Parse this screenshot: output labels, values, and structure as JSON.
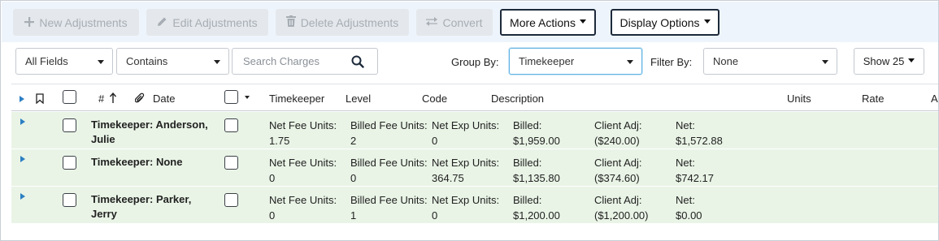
{
  "toolbar": {
    "new_label": "New Adjustments",
    "edit_label": "Edit Adjustments",
    "delete_label": "Delete Adjustments",
    "convert_label": "Convert",
    "more_actions_label": "More Actions",
    "display_options_label": "Display Options"
  },
  "filters": {
    "field_select": "All Fields",
    "operator_select": "Contains",
    "search_placeholder": "Search Charges",
    "group_by_label": "Group By:",
    "group_by_value": "Timekeeper",
    "filter_by_label": "Filter By:",
    "filter_by_value": "None",
    "show_label": "Show 25"
  },
  "table": {
    "headers": {
      "number": "#",
      "date": "Date",
      "timekeeper": "Timekeeper",
      "level": "Level",
      "code": "Code",
      "description": "Description",
      "units": "Units",
      "rate": "Rate",
      "amount_cut": "A"
    },
    "groups": [
      {
        "name": "Timekeeper: Anderson, Julie",
        "net_fee_units_label": "Net Fee Units:",
        "net_fee_units": "1.75",
        "billed_fee_units_label": "Billed Fee Units:",
        "billed_fee_units": "2",
        "net_exp_units_label": "Net Exp Units:",
        "net_exp_units": "0",
        "billed_label": "Billed:",
        "billed": "$1,959.00",
        "client_adj_label": "Client Adj:",
        "client_adj": "($240.00)",
        "net_label": "Net:",
        "net": "$1,572.88"
      },
      {
        "name": "Timekeeper: None",
        "net_fee_units_label": "Net Fee Units:",
        "net_fee_units": "0",
        "billed_fee_units_label": "Billed Fee Units:",
        "billed_fee_units": "0",
        "net_exp_units_label": "Net Exp Units:",
        "net_exp_units": "364.75",
        "billed_label": "Billed:",
        "billed": "$1,135.80",
        "client_adj_label": "Client Adj:",
        "client_adj": "($374.60)",
        "net_label": "Net:",
        "net": "$742.17"
      },
      {
        "name": "Timekeeper: Parker, Jerry",
        "net_fee_units_label": "Net Fee Units:",
        "net_fee_units": "0",
        "billed_fee_units_label": "Billed Fee Units:",
        "billed_fee_units": "1",
        "net_exp_units_label": "Net Exp Units:",
        "net_exp_units": "0",
        "billed_label": "Billed:",
        "billed": "$1,200.00",
        "client_adj_label": "Client Adj:",
        "client_adj": "($1,200.00)",
        "net_label": "Net:",
        "net": "$0.00"
      }
    ]
  },
  "colors": {
    "toolbar_bg": "#eef4fb",
    "disabled_button_bg": "#e4e8ec",
    "group_row_bg": "#e9f4e6",
    "accent_blue": "#2c7fc3",
    "focus_border": "#5fb3e4"
  },
  "icons": {
    "new": "plus-icon",
    "edit": "pencil-icon",
    "delete": "trash-icon",
    "convert": "swap-arrows-icon",
    "search": "magnifier-icon",
    "bookmark": "bookmark-icon",
    "attachment": "paperclip-icon",
    "sort": "arrow-up-icon",
    "expand": "triangle-right-icon"
  }
}
